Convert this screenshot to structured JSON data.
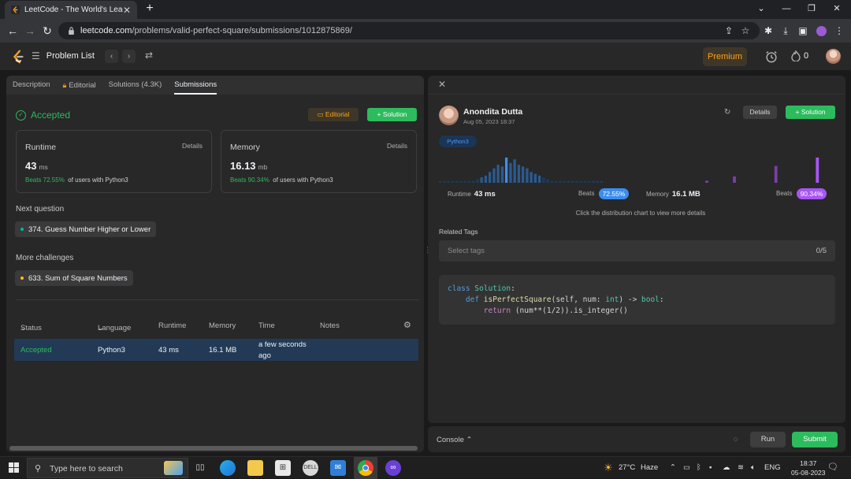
{
  "browser": {
    "tab_title": "LeetCode - The World's Leading",
    "url_domain": "leetcode.com",
    "url_path": "/problems/valid-perfect-square/submissions/1012875869/"
  },
  "nav": {
    "problem_list": "Problem List",
    "premium": "Premium",
    "streak": "0"
  },
  "left": {
    "tabs": [
      "Description",
      "Editorial",
      "Solutions (4.3K)",
      "Submissions"
    ],
    "status": "Accepted",
    "editorial_btn": "Editorial",
    "solution_btn": "Solution",
    "runtime": {
      "label": "Runtime",
      "details": "Details",
      "value": "43",
      "unit": "ms",
      "beats": "Beats 72.55%",
      "suffix": "of users with Python3"
    },
    "memory": {
      "label": "Memory",
      "details": "Details",
      "value": "16.13",
      "unit": "mb",
      "beats": "Beats 90.34%",
      "suffix": "of users with Python3"
    },
    "next_question_label": "Next question",
    "next_question": "374. Guess Number Higher or Lower",
    "more_challenges_label": "More challenges",
    "more_challenge": "633. Sum of Square Numbers",
    "table": {
      "headers": [
        "Status",
        "Language",
        "Runtime",
        "Memory",
        "Time",
        "Notes"
      ],
      "row": {
        "status": "Accepted",
        "language": "Python3",
        "runtime": "43 ms",
        "memory": "16.1 MB",
        "time_line1": "a few seconds",
        "time_line2": "ago"
      }
    }
  },
  "right": {
    "user_name": "Anondita Dutta",
    "date": "Aug 05, 2023 18:37",
    "details_btn": "Details",
    "solution_btn": "Solution",
    "language": "Python3",
    "runtime_label": "Runtime",
    "runtime_value": "43 ms",
    "runtime_beats_label": "Beats",
    "runtime_beats": "72.55%",
    "memory_label": "Memory",
    "memory_value": "16.1 MB",
    "memory_beats_label": "Beats",
    "memory_beats": "90.34%",
    "hint": "Click the distribution chart to view more details",
    "related_tags": "Related Tags",
    "tags_placeholder": "Select tags",
    "tags_count": "0/5",
    "code": {
      "l1_kw": "class",
      "l1_name": "Solution",
      "l2_kw": "def",
      "l2_fn": "isPerfectSquare",
      "l2_args": "(self, num: ",
      "l2_t1": "int",
      "l2_arrow": ") -> ",
      "l2_t2": "bool",
      "l3_kw": "return",
      "l3_body": "(num**(1/2)).is_integer()"
    }
  },
  "console": {
    "label": "Console",
    "run": "Run",
    "submit": "Submit"
  },
  "taskbar": {
    "search_placeholder": "Type here to search",
    "weather": "27°C",
    "weather_desc": "Haze",
    "lang": "ENG",
    "time": "18:37",
    "date": "05-08-2023"
  },
  "colors": {
    "accent_green": "#2cbb5d",
    "orange": "#ffa116",
    "blue": "#3b8ef0",
    "purple": "#a855f7"
  },
  "chart_data": {
    "type": "bar",
    "series": [
      {
        "name": "Runtime",
        "values": [
          1,
          1,
          1,
          1,
          1,
          1,
          1,
          1,
          1,
          2,
          3,
          4,
          6,
          8,
          10,
          9,
          14,
          11,
          13,
          10,
          9,
          8,
          6,
          5,
          4,
          3,
          2,
          1,
          1,
          1,
          1,
          1,
          1,
          1,
          1,
          1,
          1,
          1,
          1,
          1
        ],
        "highlight_index": 16
      },
      {
        "name": "Memory",
        "values": [
          0,
          0,
          0,
          0,
          0,
          0,
          0,
          0,
          0,
          0,
          0,
          0,
          0,
          1,
          0,
          0,
          0,
          0,
          0,
          3,
          0,
          0,
          0,
          0,
          0,
          0,
          0,
          0,
          8,
          0,
          0,
          0,
          0,
          0,
          0,
          0,
          0,
          12,
          0,
          0
        ],
        "highlight_index": 37
      }
    ]
  }
}
